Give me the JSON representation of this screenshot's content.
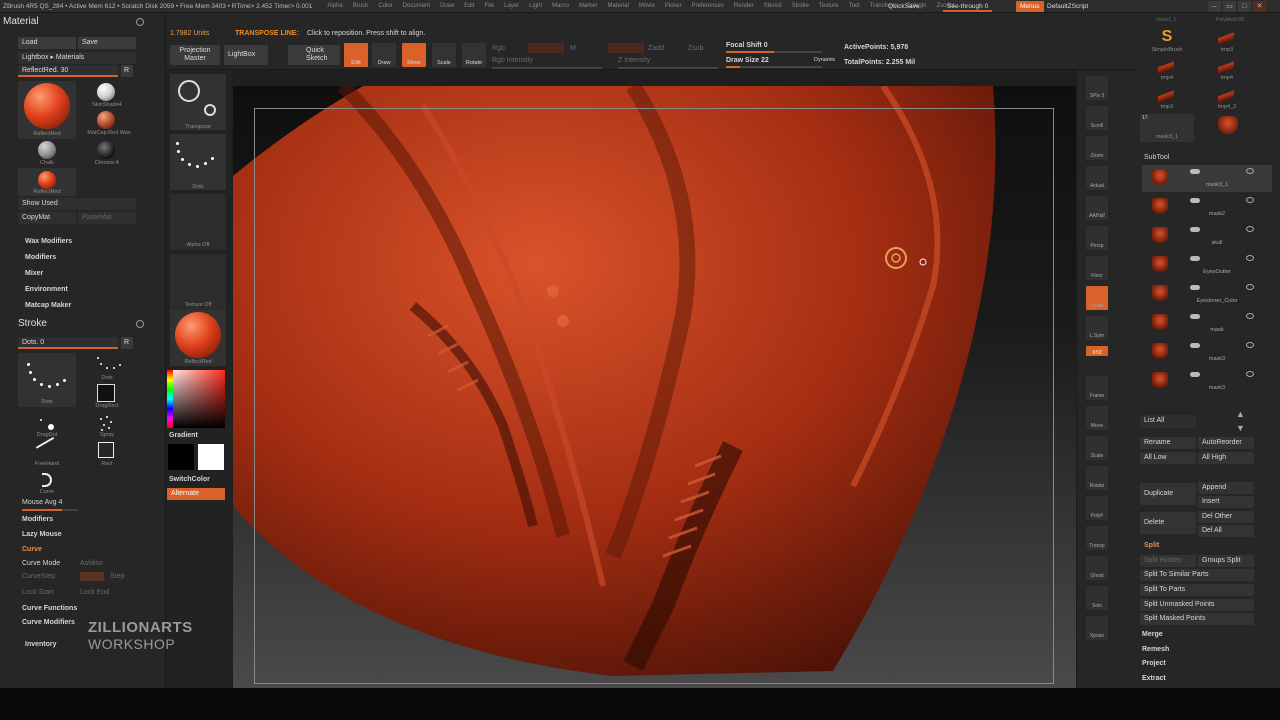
{
  "topbar": {
    "app_info": "ZBrush 4R5     QS_284     • Active Mem 612 • Scratch Disk 2059 • Free Mem 3403 • RTime> 2.452 Timer> 0.001",
    "menus": [
      "Alpha",
      "Brush",
      "Color",
      "Document",
      "Draw",
      "Edit",
      "File",
      "Layer",
      "Light",
      "Macro",
      "Marker",
      "Material",
      "Movie",
      "Picker",
      "Preferences",
      "Render",
      "Stencil",
      "Stroke",
      "Texture",
      "Tool",
      "Transform",
      "Zplugin",
      "Zscript"
    ],
    "quicksave": "QuickSave",
    "seethrough": "See-through  0",
    "menus_btn": "Menus",
    "default_script": "DefaultZScript"
  },
  "toolbar": {
    "units": "1.7982  Units",
    "transpose_title": "TRANSPOSE LINE:",
    "transpose_hint": "Click to reposition. Press shift to align.",
    "projection_master": "Projection Master",
    "lightbox": "LightBox",
    "quick_sketch": "Quick Sketch",
    "edit": "Edit",
    "draw": "Draw",
    "move": "Move",
    "scale": "Scale",
    "rotate": "Rotate",
    "rgb": "Rgb",
    "m_label": "M",
    "mrgb": "Mrgb",
    "zadd": "Zadd",
    "zsub": "Zsub",
    "rgb_intensity": "Rgb Intensity",
    "z_intensity": "Z Intensity",
    "focal_shift": "Focal Shift 0",
    "draw_size": "Draw Size 22",
    "dynamic": "Dynamic",
    "active_points": "ActivePoints: 5,978",
    "total_points": "TotalPoints: 2.255 Mil"
  },
  "material": {
    "title": "Material",
    "load": "Load",
    "save": "Save",
    "lightbox_materials": "Lightbox ▸ Materials",
    "reflected_label": "ReflectRed. 30",
    "r_btn": "R",
    "big_label": "ReflectRed",
    "mats": [
      "SkinShade4",
      "MatCap Red Wax",
      "Chalk",
      "Chrome A",
      "ReflectRed"
    ],
    "show_used": "Show Used",
    "copy_mat": "CopyMat",
    "paste_mat": "PasteMat",
    "sections": [
      "Wax Modifiers",
      "Modifiers",
      "Mixer",
      "Environment",
      "Matcap Maker"
    ]
  },
  "stroke": {
    "title": "Stroke",
    "dots_label": "Dots. 0",
    "r_btn": "R",
    "types": [
      "Dots",
      "Dots",
      "DragRect",
      "DragDot",
      "Spray",
      "FreeHand",
      "Rect",
      "Curve"
    ],
    "mouse_avg": "Mouse Avg 4",
    "items": [
      "Modifiers",
      "Lazy Mouse",
      "Curve",
      "Curve Mode",
      "Curve Functions",
      "Curve Modifiers",
      "Inventory"
    ],
    "curve_mode_extra": "Asfalso",
    "curve_step": "CurveStep",
    "step": "Step",
    "lock_start": "Lock Start",
    "lock_end": "Lock End"
  },
  "col2": {
    "transpose": "Transpose",
    "dots": "Dots",
    "alpha_off": "Alpha Off",
    "texture_off": "Texture Off",
    "reflected": "ReflectRed",
    "gradient": "Gradient",
    "switch_color": "SwitchColor",
    "alternate": "Alternate"
  },
  "right_icons": [
    "SPix 3",
    "Scroll",
    "Zoom",
    "Actual",
    "AAHalf",
    "Persp",
    "Floor",
    "Local",
    "L.Sym",
    "XYZ",
    "Frame",
    "Move",
    "Scale",
    "Rotate",
    "PolyF",
    "Transp",
    "Ghost",
    "Solo",
    "Xpose"
  ],
  "tools": {
    "items": [
      "SimpleBrush",
      "tmp3",
      "tmp4",
      "tmp4",
      "tmp3",
      "tmp4_3",
      "mask3_1"
    ],
    "top_labels": [
      "mask3_1",
      "PolyMesh3D"
    ],
    "count": "17"
  },
  "subtool": {
    "title": "SubTool",
    "items": [
      "mask3_1",
      "mask2",
      "skull",
      "EyesOutter",
      "EyesInner_Color",
      "mask",
      "mask3",
      "mask3"
    ],
    "list_all": "List All",
    "rename": "Rename",
    "autoreorder": "AutoReorder",
    "all_low": "All Low",
    "all_high": "All High",
    "duplicate": "Duplicate",
    "append": "Append",
    "insert": "Insert",
    "delete": "Delete",
    "del_other": "Del Other",
    "del_all": "Del All",
    "split": "Split",
    "split_hidden": "Split Hidden",
    "groups_split": "Groups Split",
    "split_similar": "Split To Similar Parts",
    "split_parts": "Split To Parts",
    "split_unmasked": "Split Unmasked Points",
    "split_masked": "Split Masked Points",
    "merge": "Merge",
    "remesh": "Remesh",
    "project": "Project",
    "extract": "Extract"
  },
  "watermark": {
    "line1": "ZILLIONARTS",
    "line2": "WORKSHOP"
  },
  "colors": {
    "accent": "#d9622b",
    "model": "#c23a1a",
    "panel": "#262626"
  }
}
